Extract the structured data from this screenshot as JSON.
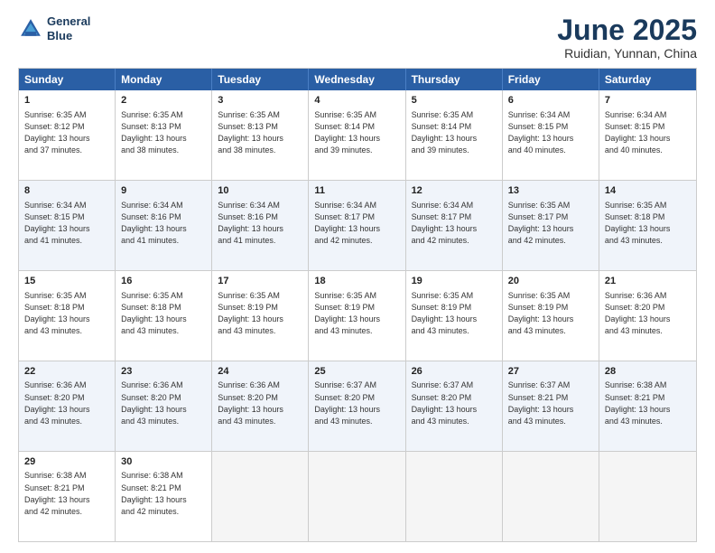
{
  "header": {
    "logo_line1": "General",
    "logo_line2": "Blue",
    "month": "June 2025",
    "location": "Ruidian, Yunnan, China"
  },
  "weekdays": [
    "Sunday",
    "Monday",
    "Tuesday",
    "Wednesday",
    "Thursday",
    "Friday",
    "Saturday"
  ],
  "rows": [
    [
      {
        "day": "1",
        "info": "Sunrise: 6:35 AM\nSunset: 8:12 PM\nDaylight: 13 hours\nand 37 minutes."
      },
      {
        "day": "2",
        "info": "Sunrise: 6:35 AM\nSunset: 8:13 PM\nDaylight: 13 hours\nand 38 minutes."
      },
      {
        "day": "3",
        "info": "Sunrise: 6:35 AM\nSunset: 8:13 PM\nDaylight: 13 hours\nand 38 minutes."
      },
      {
        "day": "4",
        "info": "Sunrise: 6:35 AM\nSunset: 8:14 PM\nDaylight: 13 hours\nand 39 minutes."
      },
      {
        "day": "5",
        "info": "Sunrise: 6:35 AM\nSunset: 8:14 PM\nDaylight: 13 hours\nand 39 minutes."
      },
      {
        "day": "6",
        "info": "Sunrise: 6:34 AM\nSunset: 8:15 PM\nDaylight: 13 hours\nand 40 minutes."
      },
      {
        "day": "7",
        "info": "Sunrise: 6:34 AM\nSunset: 8:15 PM\nDaylight: 13 hours\nand 40 minutes."
      }
    ],
    [
      {
        "day": "8",
        "info": "Sunrise: 6:34 AM\nSunset: 8:15 PM\nDaylight: 13 hours\nand 41 minutes."
      },
      {
        "day": "9",
        "info": "Sunrise: 6:34 AM\nSunset: 8:16 PM\nDaylight: 13 hours\nand 41 minutes."
      },
      {
        "day": "10",
        "info": "Sunrise: 6:34 AM\nSunset: 8:16 PM\nDaylight: 13 hours\nand 41 minutes."
      },
      {
        "day": "11",
        "info": "Sunrise: 6:34 AM\nSunset: 8:17 PM\nDaylight: 13 hours\nand 42 minutes."
      },
      {
        "day": "12",
        "info": "Sunrise: 6:34 AM\nSunset: 8:17 PM\nDaylight: 13 hours\nand 42 minutes."
      },
      {
        "day": "13",
        "info": "Sunrise: 6:35 AM\nSunset: 8:17 PM\nDaylight: 13 hours\nand 42 minutes."
      },
      {
        "day": "14",
        "info": "Sunrise: 6:35 AM\nSunset: 8:18 PM\nDaylight: 13 hours\nand 43 minutes."
      }
    ],
    [
      {
        "day": "15",
        "info": "Sunrise: 6:35 AM\nSunset: 8:18 PM\nDaylight: 13 hours\nand 43 minutes."
      },
      {
        "day": "16",
        "info": "Sunrise: 6:35 AM\nSunset: 8:18 PM\nDaylight: 13 hours\nand 43 minutes."
      },
      {
        "day": "17",
        "info": "Sunrise: 6:35 AM\nSunset: 8:19 PM\nDaylight: 13 hours\nand 43 minutes."
      },
      {
        "day": "18",
        "info": "Sunrise: 6:35 AM\nSunset: 8:19 PM\nDaylight: 13 hours\nand 43 minutes."
      },
      {
        "day": "19",
        "info": "Sunrise: 6:35 AM\nSunset: 8:19 PM\nDaylight: 13 hours\nand 43 minutes."
      },
      {
        "day": "20",
        "info": "Sunrise: 6:35 AM\nSunset: 8:19 PM\nDaylight: 13 hours\nand 43 minutes."
      },
      {
        "day": "21",
        "info": "Sunrise: 6:36 AM\nSunset: 8:20 PM\nDaylight: 13 hours\nand 43 minutes."
      }
    ],
    [
      {
        "day": "22",
        "info": "Sunrise: 6:36 AM\nSunset: 8:20 PM\nDaylight: 13 hours\nand 43 minutes."
      },
      {
        "day": "23",
        "info": "Sunrise: 6:36 AM\nSunset: 8:20 PM\nDaylight: 13 hours\nand 43 minutes."
      },
      {
        "day": "24",
        "info": "Sunrise: 6:36 AM\nSunset: 8:20 PM\nDaylight: 13 hours\nand 43 minutes."
      },
      {
        "day": "25",
        "info": "Sunrise: 6:37 AM\nSunset: 8:20 PM\nDaylight: 13 hours\nand 43 minutes."
      },
      {
        "day": "26",
        "info": "Sunrise: 6:37 AM\nSunset: 8:20 PM\nDaylight: 13 hours\nand 43 minutes."
      },
      {
        "day": "27",
        "info": "Sunrise: 6:37 AM\nSunset: 8:21 PM\nDaylight: 13 hours\nand 43 minutes."
      },
      {
        "day": "28",
        "info": "Sunrise: 6:38 AM\nSunset: 8:21 PM\nDaylight: 13 hours\nand 43 minutes."
      }
    ],
    [
      {
        "day": "29",
        "info": "Sunrise: 6:38 AM\nSunset: 8:21 PM\nDaylight: 13 hours\nand 42 minutes."
      },
      {
        "day": "30",
        "info": "Sunrise: 6:38 AM\nSunset: 8:21 PM\nDaylight: 13 hours\nand 42 minutes."
      },
      {
        "day": "",
        "info": ""
      },
      {
        "day": "",
        "info": ""
      },
      {
        "day": "",
        "info": ""
      },
      {
        "day": "",
        "info": ""
      },
      {
        "day": "",
        "info": ""
      }
    ]
  ]
}
